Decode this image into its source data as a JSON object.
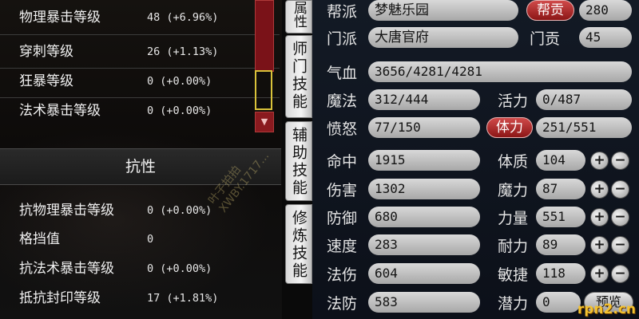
{
  "left_panel": {
    "top_stats": [
      {
        "name": "物理暴击等级",
        "value": "48 (+6.96%)"
      },
      {
        "name": "穿刺等级",
        "value": "26 (+1.13%)"
      },
      {
        "name": "狂暴等级",
        "value": "0 (+0.00%)"
      },
      {
        "name": "法术暴击等级",
        "value": "0 (+0.00%)"
      }
    ],
    "resist_section_title": "抗性",
    "resist_stats": [
      {
        "name": "抗物理暴击等级",
        "value": "0 (+0.00%)"
      },
      {
        "name": "格挡值",
        "value": "0"
      },
      {
        "name": "抗法术暴击等级",
        "value": "0 (+0.00%)"
      },
      {
        "name": "抵抗封印等级",
        "value": "17 (+1.81%)"
      }
    ],
    "watermark": "叶子拍拍 XWBY.1717...",
    "scroll_arrow": "▼"
  },
  "tabs": [
    {
      "label": "属性"
    },
    {
      "label": "师门技能"
    },
    {
      "label": "辅助技能"
    },
    {
      "label": "修炼技能"
    }
  ],
  "right_panel": {
    "faction_label": "帮派",
    "faction_value": "梦魅乐园",
    "faction_contrib_button": "帮贡",
    "faction_contrib_value": "280",
    "school_label": "门派",
    "school_value": "大唐官府",
    "school_contrib_label": "门贡",
    "school_contrib_value": "45",
    "hp_label": "气血",
    "hp_value": "3656/4281/4281",
    "mp_label": "魔法",
    "mp_value": "312/444",
    "vitality_label": "活力",
    "vitality_value": "0/487",
    "rage_label": "愤怒",
    "rage_value": "77/150",
    "stamina_button": "体力",
    "stamina_value": "251/551",
    "combat": [
      {
        "label": "命中",
        "value": "1915"
      },
      {
        "label": "伤害",
        "value": "1302"
      },
      {
        "label": "防御",
        "value": "680"
      },
      {
        "label": "速度",
        "value": "283"
      },
      {
        "label": "法伤",
        "value": "604"
      },
      {
        "label": "法防",
        "value": "583"
      }
    ],
    "attributes": [
      {
        "label": "体质",
        "value": "104"
      },
      {
        "label": "魔力",
        "value": "87"
      },
      {
        "label": "力量",
        "value": "551"
      },
      {
        "label": "耐力",
        "value": "89"
      },
      {
        "label": "敏捷",
        "value": "118"
      },
      {
        "label": "潜力",
        "value": "0"
      }
    ],
    "plus_symbol": "+",
    "minus_symbol": "−",
    "preview_button": "预览"
  },
  "site_watermark": "rpn2.cn",
  "colors": {
    "field_gray": "#c4c4c4",
    "button_red": "#b02a2a",
    "accent_yellow": "#d9c23a",
    "panel_bg": "#101620"
  }
}
